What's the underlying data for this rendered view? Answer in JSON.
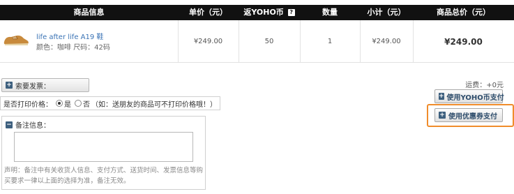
{
  "table": {
    "headers": {
      "product_info": "商品信息",
      "unit_price": "单价（元）",
      "yoho_coin": "返YOHO币",
      "yoho_coin_help": "?",
      "quantity": "数量",
      "subtotal": "小计（元）",
      "total": "商品总价（元）"
    },
    "row": {
      "product_name": "life after life A19 鞋",
      "product_attrs": "颜色：咖啡 尺码：42码",
      "unit_price": "¥249.00",
      "yoho_coin": "50",
      "quantity": "1",
      "subtotal": "¥249.00",
      "total": "¥249.00"
    }
  },
  "invoice": {
    "icon": "plus-square-icon",
    "label": "索要发票："
  },
  "print_price": {
    "label": "是否打印价格：",
    "option_yes": "是",
    "option_no": "否",
    "selected": "是",
    "hint": "（如：送朋友的商品可不打印价格哦！）"
  },
  "remark": {
    "icon": "minus-square-icon",
    "title": "备注信息：",
    "value": "",
    "note": "声明：备注中有关收货人信息、支付方式、送货时间、发票信息等购买要求一律以上面的选择为准，备注无效。"
  },
  "shipping": {
    "label": "运费：",
    "value": "+0元"
  },
  "payment": {
    "yoho_coin_button": "使用YOHO币支付",
    "coupon_button": "使用优惠券支付"
  },
  "colors": {
    "header_bg": "#111111",
    "link_blue": "#3a73b5",
    "highlight_orange": "#f08c2b"
  }
}
